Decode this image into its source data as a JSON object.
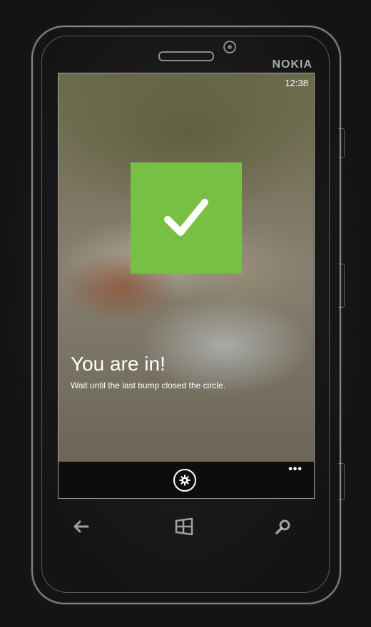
{
  "device": {
    "brand": "NOKIA",
    "keys": [
      "back-icon",
      "windows-icon",
      "search-icon"
    ]
  },
  "status_bar": {
    "time": "12:38"
  },
  "main": {
    "status_icon": "checkmark-icon",
    "headline": "You are in!",
    "message": "Wait until the last bump closed the circle."
  },
  "app_bar": {
    "button_icon": "gear-icon",
    "more_label": "•••"
  },
  "colors": {
    "accent": "#77c043",
    "app_bar_bg": "#0d0d0d",
    "text": "#ffffff"
  }
}
